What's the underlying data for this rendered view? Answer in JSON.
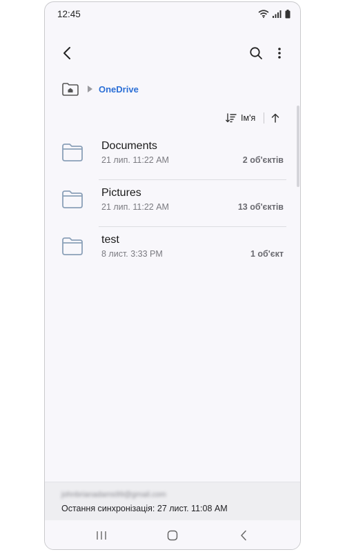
{
  "status_bar": {
    "time": "12:45"
  },
  "breadcrumb": {
    "location": "OneDrive"
  },
  "sort": {
    "label": "Ім'я"
  },
  "files": [
    {
      "name": "Documents",
      "date": "21 лип. 11:22 AM",
      "count": "2 об'єктів"
    },
    {
      "name": "Pictures",
      "date": "21 лип. 11:22 AM",
      "count": "13 об'єктів"
    },
    {
      "name": "test",
      "date": "8 лист. 3:33 PM",
      "count": "1 об'єкт"
    }
  ],
  "footer": {
    "account_email": "johnbrianadams99@gmail.com",
    "last_sync": "Остання синхронізація: 27 лист. 11:08 AM"
  },
  "icons": {
    "back": "back-arrow-icon",
    "search": "search-icon",
    "more": "more-vertical-icon",
    "home": "home-icon",
    "folder": "folder-icon",
    "sort": "sort-icon",
    "sort_direction": "arrow-up-icon"
  },
  "colors": {
    "accent": "#2b6fd6",
    "folder_stroke": "#8aa0b8",
    "background": "#f8f7fb"
  }
}
